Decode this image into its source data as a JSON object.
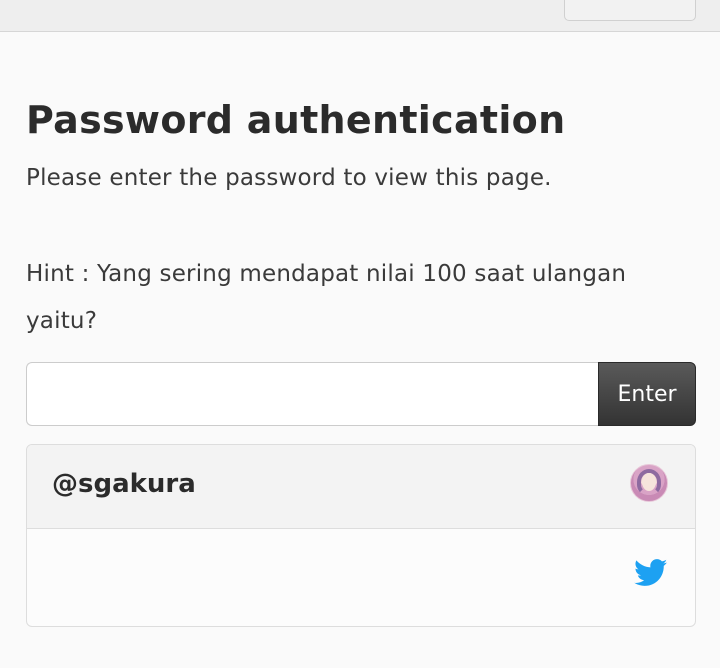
{
  "page": {
    "title": "Password authentication",
    "instruction": "Please enter the password to view this page.",
    "hint": "Hint : Yang sering mendapat nilai 100 saat ulangan yaitu?"
  },
  "form": {
    "password_value": "",
    "password_placeholder": "",
    "enter_label": "Enter"
  },
  "author": {
    "name": "@sgakura",
    "avatar_icon": "avatar-image",
    "social_icon": "twitter-icon"
  },
  "colors": {
    "background": "#fafafa",
    "twitter_blue": "#1da1f2",
    "button_dark": "#3d3d3d"
  }
}
